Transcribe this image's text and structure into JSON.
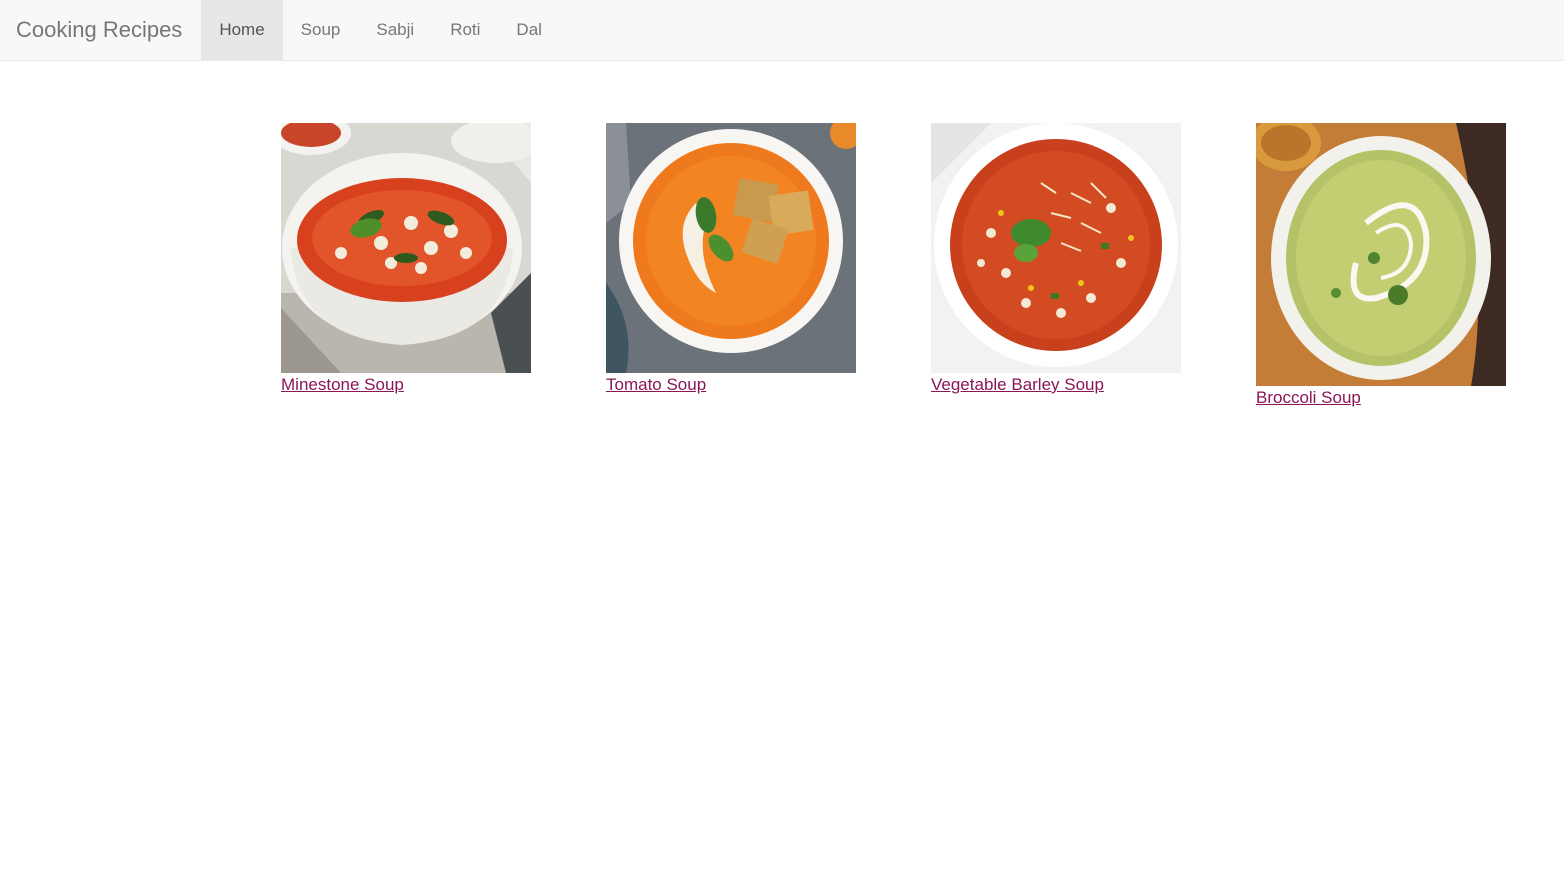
{
  "navbar": {
    "brand": "Cooking Recipes",
    "items": [
      {
        "label": "Home",
        "active": true
      },
      {
        "label": "Soup",
        "active": false
      },
      {
        "label": "Sabji",
        "active": false
      },
      {
        "label": "Roti",
        "active": false
      },
      {
        "label": "Dal",
        "active": false
      }
    ]
  },
  "recipes": [
    {
      "title": "Minestone Soup",
      "image": "minestrone-soup-photo"
    },
    {
      "title": "Tomato Soup",
      "image": "tomato-soup-photo"
    },
    {
      "title": "Vegetable Barley Soup",
      "image": "vegetable-barley-soup-photo"
    },
    {
      "title": "Broccoli Soup",
      "image": "broccoli-soup-photo"
    }
  ],
  "colors": {
    "link": "#8b1656",
    "navbar_bg": "#f8f8f8",
    "nav_active_bg": "#e7e7e7",
    "nav_text": "#777777"
  }
}
